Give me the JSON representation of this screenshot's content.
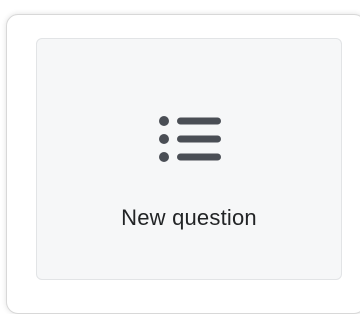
{
  "new_question_card": {
    "label": "New question",
    "icon": "list-icon",
    "icon_color": "#4a4e55",
    "background_color": "#f6f7f8"
  }
}
